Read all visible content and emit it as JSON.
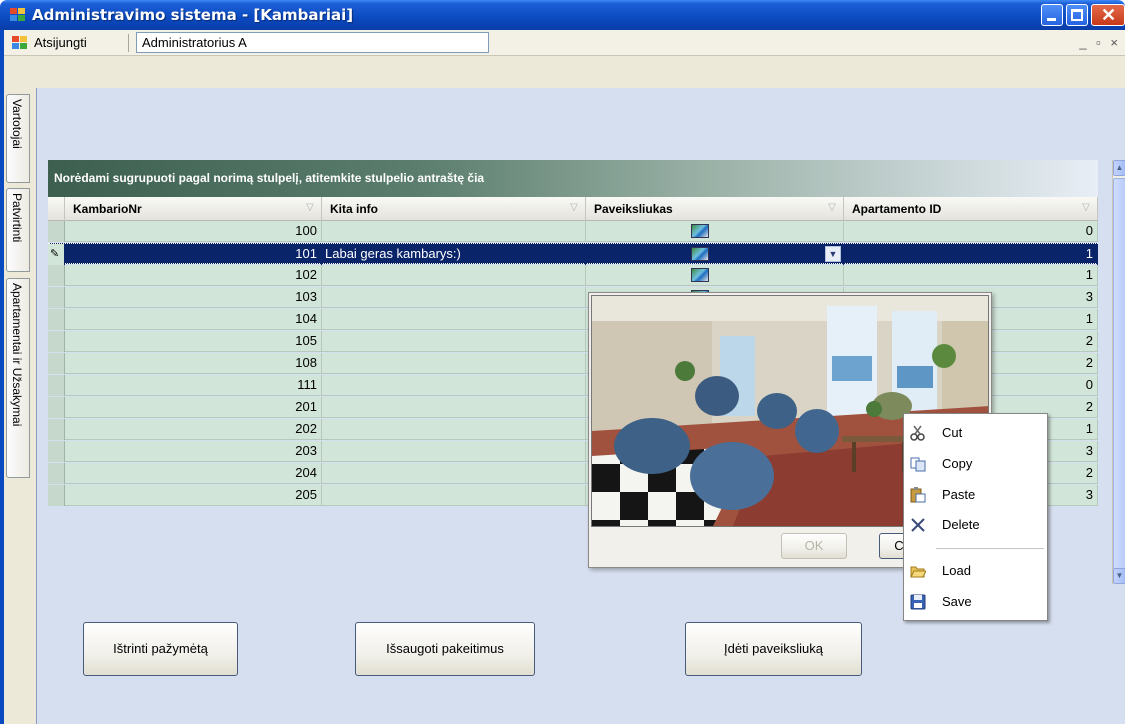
{
  "window": {
    "title": "Administravimo sistema - [Kambariai]"
  },
  "menu": {
    "logout_label": "Atsijungti",
    "user_value": "Administratorius A",
    "mdi_controls": "_ ▫ ×"
  },
  "side_tabs": [
    {
      "label": "Vartotojai"
    },
    {
      "label": "Patvirtinti"
    },
    {
      "label": "Apartamentai ir Užsakymai"
    }
  ],
  "grid": {
    "group_hint": "Norėdami sugrupuoti pagal norimą stulpelį, atitemkite stulpelio antraštę čia",
    "columns": [
      {
        "label": "KambarioNr"
      },
      {
        "label": "Kita info"
      },
      {
        "label": "Paveiksliukas"
      },
      {
        "label": "Apartamento ID"
      }
    ],
    "rows": [
      {
        "nr": "100",
        "info": "",
        "apt": "0"
      },
      {
        "nr": "101",
        "info": "Labai geras kambarys:)",
        "apt": "1",
        "selected": true,
        "editing": true
      },
      {
        "nr": "102",
        "info": "",
        "apt": "1"
      },
      {
        "nr": "103",
        "info": "",
        "apt": "3"
      },
      {
        "nr": "104",
        "info": "",
        "apt": "1"
      },
      {
        "nr": "105",
        "info": "",
        "apt": "2"
      },
      {
        "nr": "108",
        "info": "",
        "apt": "2"
      },
      {
        "nr": "111",
        "info": "",
        "apt": "0"
      },
      {
        "nr": "201",
        "info": "",
        "apt": "2"
      },
      {
        "nr": "202",
        "info": "",
        "apt": "1"
      },
      {
        "nr": "203",
        "info": "",
        "apt": "3"
      },
      {
        "nr": "204",
        "info": "",
        "apt": "2"
      },
      {
        "nr": "205",
        "info": "",
        "apt": "3"
      }
    ]
  },
  "popup": {
    "ok_label": "OK",
    "cancel_label": "C"
  },
  "context_menu": [
    {
      "label": "Cut",
      "icon": "scissors-icon"
    },
    {
      "label": "Copy",
      "icon": "copy-icon"
    },
    {
      "label": "Paste",
      "icon": "paste-icon"
    },
    {
      "label": "Delete",
      "icon": "delete-x-icon"
    },
    {
      "label": "Load",
      "icon": "folder-open-icon"
    },
    {
      "label": "Save",
      "icon": "floppy-disk-icon"
    }
  ],
  "buttons": {
    "delete_label": "Ištrinti pažymėtą",
    "save_label": "Išsaugoti pakeitimus",
    "add_image_label": "Įdėti paveiksliuką"
  },
  "colors": {
    "titlebar": "#0b4ac0",
    "panel": "#d6dff0",
    "row_bg": "#d1e5d9",
    "selected_row": "#0a246a"
  }
}
